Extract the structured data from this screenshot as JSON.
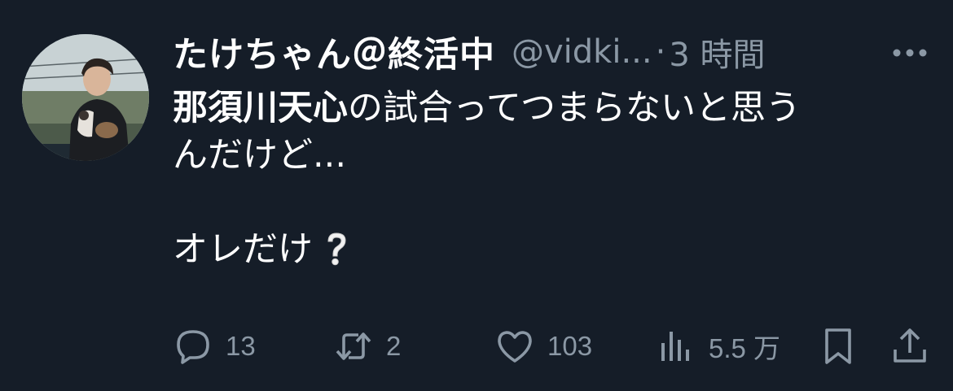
{
  "tweet": {
    "author": {
      "display_name": "たけちゃん＠終活中",
      "handle": "@vidki...",
      "separator": "·",
      "time": "3 時間"
    },
    "body": {
      "line1_bold": "那須川天心",
      "line1_rest": "の試合ってつまらないと思う",
      "line2": "んだけど...",
      "line3": "オレだけ",
      "emoji": "white-question-mark"
    },
    "actions": {
      "reply_count": "13",
      "retweet_count": "2",
      "like_count": "103",
      "views_count": "5.5 万"
    },
    "icons": {
      "more": "more-horizontal-icon",
      "reply": "reply-icon",
      "retweet": "retweet-icon",
      "like": "heart-icon",
      "views": "views-chart-icon",
      "bookmark": "bookmark-icon",
      "share": "share-icon"
    },
    "colors": {
      "background": "#151d28",
      "primary_text": "#ffffff",
      "secondary_text": "#8b98a5"
    }
  }
}
